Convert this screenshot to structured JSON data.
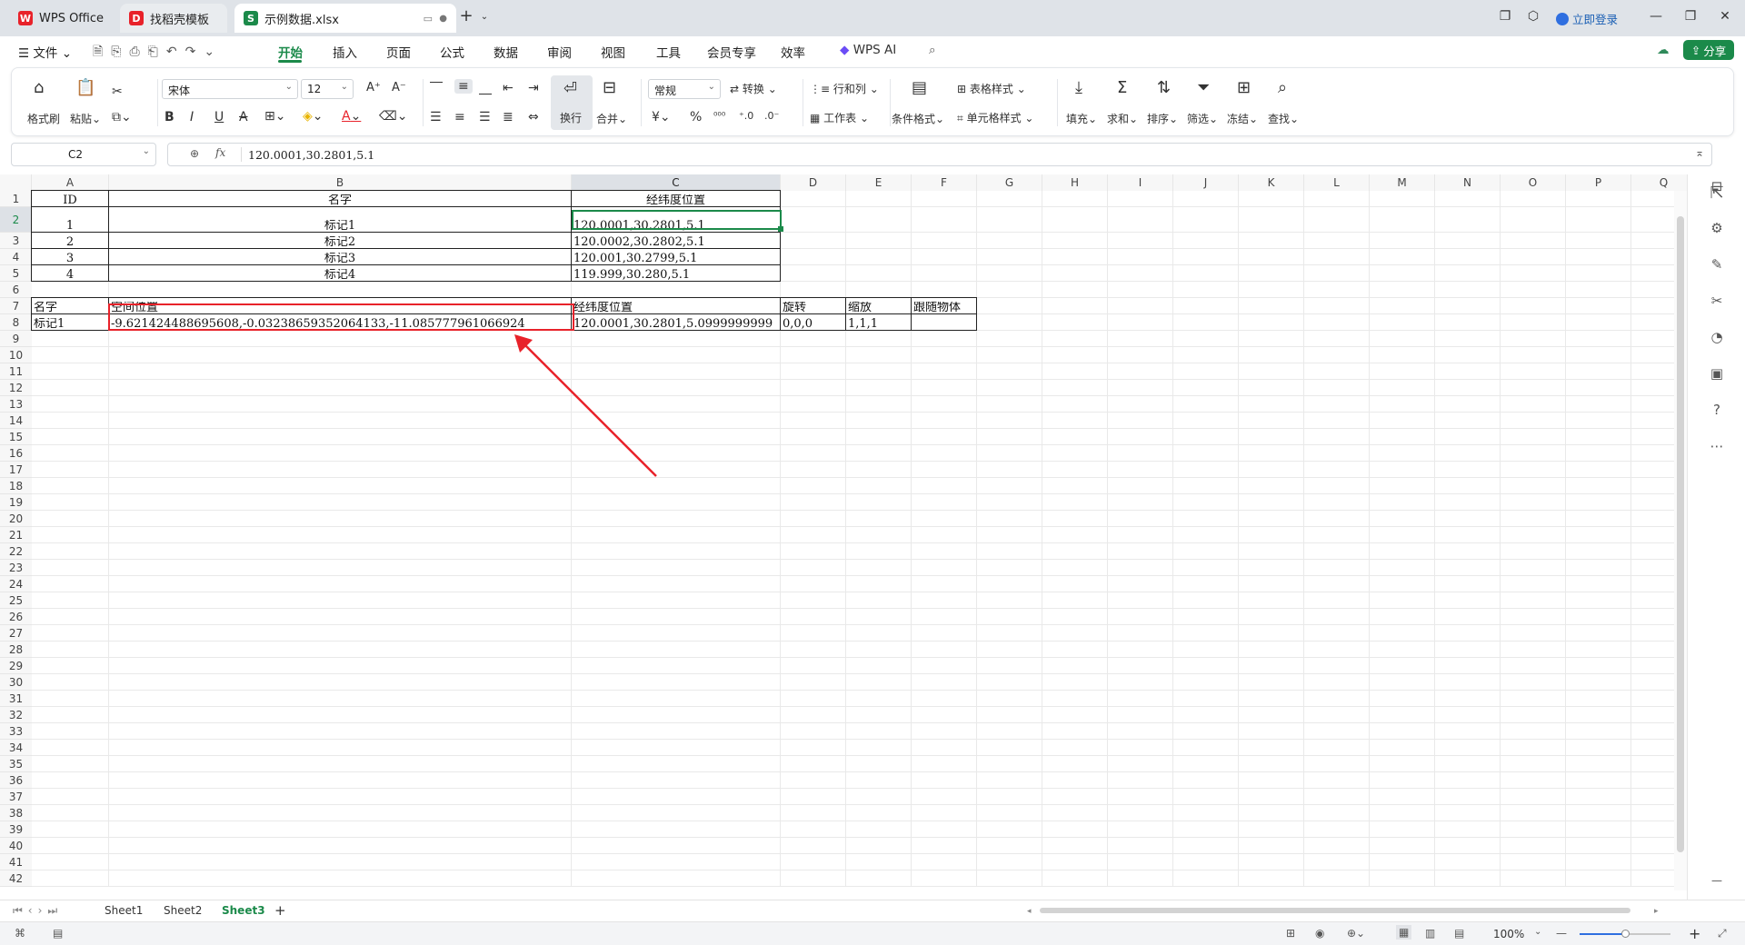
{
  "titlebar": {
    "tabs": [
      {
        "label": "WPS Office",
        "icon": "wps-logo-icon"
      },
      {
        "label": "找稻壳模板",
        "icon": "docer-icon"
      },
      {
        "label": "示例数据.xlsx",
        "icon": "spreadsheet-icon"
      }
    ],
    "login_label": "立即登录"
  },
  "menubar": {
    "file_label": "文件",
    "items": [
      "开始",
      "插入",
      "页面",
      "公式",
      "数据",
      "审阅",
      "视图",
      "工具",
      "会员专享",
      "效率"
    ],
    "active_item": "开始",
    "wps_ai_label": "WPS AI",
    "share_label": "分享"
  },
  "ribbon": {
    "format_painter": "格式刷",
    "paste": "粘贴",
    "font_name": "宋体",
    "font_size": "12",
    "wrap_text": "换行",
    "merge": "合并",
    "number_format": "常规",
    "convert": "转换",
    "row_col": "行和列",
    "worksheet": "工作表",
    "conditional_format": "条件格式",
    "table_style": "表格样式",
    "cell_style": "单元格样式",
    "fill": "填充",
    "sum": "求和",
    "sort": "排序",
    "filter": "筛选",
    "freeze": "冻结",
    "find": "查找"
  },
  "formula_bar": {
    "name_box": "C2",
    "formula": "120.0001,30.2801,5.1"
  },
  "columns": [
    "A",
    "B",
    "C",
    "D",
    "E",
    "F",
    "G",
    "H",
    "I",
    "J",
    "K",
    "L",
    "M",
    "N",
    "O",
    "P",
    "Q"
  ],
  "selected_column": "C",
  "selected_row": 2,
  "row_count": 42,
  "table1": {
    "headers": [
      "ID",
      "名字",
      "经纬度位置"
    ],
    "rows": [
      [
        "1",
        "标记1",
        "120.0001,30.2801,5.1"
      ],
      [
        "2",
        "标记2",
        "120.0002,30.2802,5.1"
      ],
      [
        "3",
        "标记3",
        "120.001,30.2799,5.1"
      ],
      [
        "4",
        "标记4",
        "119.999,30.280,5.1"
      ]
    ]
  },
  "table2": {
    "headers": [
      "名字",
      "空间位置",
      "经纬度位置",
      "旋转",
      "缩放",
      "跟随物体"
    ],
    "row": [
      "标记1",
      "-9.621424488695608,-0.03238659352064133,-11.085777961066924",
      "120.0001,30.2801,5.0999999999",
      "0,0,0",
      "1,1,1",
      ""
    ]
  },
  "sheets": [
    "Sheet1",
    "Sheet2",
    "Sheet3"
  ],
  "active_sheet": "Sheet3",
  "status": {
    "zoom": "100%"
  },
  "colors": {
    "accent": "#1b8a4a",
    "highlight": "#e8222a"
  }
}
